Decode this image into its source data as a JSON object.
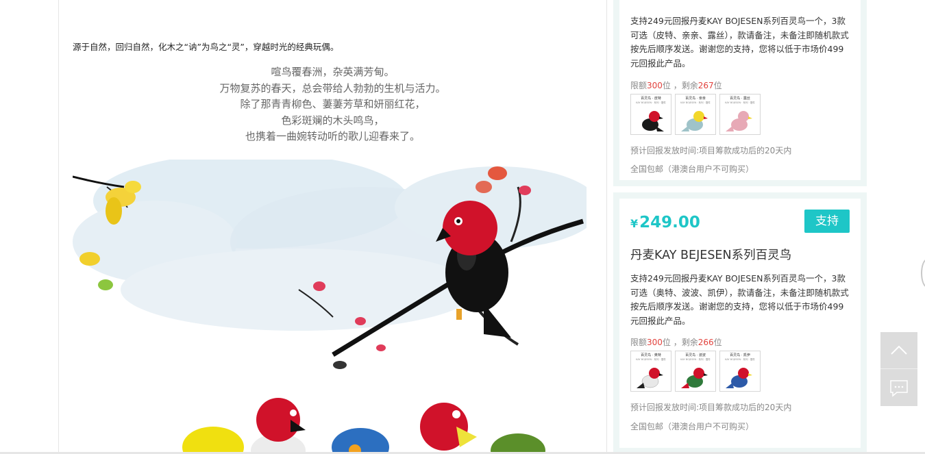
{
  "left": {
    "intro": "源于自然，回归自然，化木之“讷”为鸟之“灵”，穿越时光的经典玩偶。",
    "poem": [
      "喧鸟覆春洲，杂英满芳甸。",
      "万物复苏的春天，总会带给人勃勃的生机与活力。",
      "除了那青青柳色、萋萋芳草和妍丽红花，",
      "色彩斑斓的木头鸣鸟，",
      "也携着一曲婉转动听的歌儿迎春来了。"
    ]
  },
  "rewards": [
    {
      "description": "支持249元回报丹麦KAY BOJESEN系列百灵鸟一个，3款可选（皮特、亲亲、露丝），款请备注，未备注即随机款式按先后顺序发送。谢谢您的支持，您将以低于市场价499元回报此产品。",
      "quota_prefix": "限额",
      "quota_total": "300",
      "quota_mid": "位 ，剩余",
      "quota_left": "267",
      "quota_suffix": "位",
      "thumbs": [
        {
          "caption": "百灵鸟 · 皮特",
          "sub": "KAY BOJESEN · 系列 · 摆件",
          "color": "#1a1a1a"
        },
        {
          "caption": "百灵鸟 · 亲亲",
          "sub": "KAY BOJESEN · 系列 · 摆件",
          "color": "#9fc3c9"
        },
        {
          "caption": "百灵鸟 · 露丝",
          "sub": "KAY BOJESEN · 系列 · 摆件",
          "color": "#e7a9b6"
        }
      ],
      "delivery": "预计回报发放时间:项目筹款成功后的20天内",
      "shipping": "全国包邮（港澳台用户不可购买）"
    },
    {
      "currency": "¥",
      "price": "249.00",
      "button": "支持",
      "title": "丹麦KAY BEJESEN系列百灵鸟",
      "description": "支持249元回报丹麦KAY BOJESEN系列百灵鸟一个，3款可选（奥特、波波、凯伊），款请备注，未备注即随机款式按先后顺序发送。谢谢您的支持，您将以低于市场价499元回报此产品。",
      "quota_prefix": "限额",
      "quota_total": "300",
      "quota_mid": "位 ，剩余",
      "quota_left": "266",
      "quota_suffix": "位",
      "thumbs": [
        {
          "caption": "百灵鸟 · 奥特",
          "sub": "KAY BOJESEN · 系列 · 摆件",
          "color": "#e8e8e8"
        },
        {
          "caption": "百灵鸟 · 波波",
          "sub": "KAY BOJESEN · 系列 · 摆件",
          "color": "#2f7a3b"
        },
        {
          "caption": "百灵鸟 · 凯伊",
          "sub": "KAY BOJESEN · 系列 · 摆件",
          "color": "#2d5aa8"
        }
      ],
      "delivery": "预计回报发放时间:项目筹款成功后的20天内",
      "shipping": "全国包邮（港澳台用户不可购买）"
    }
  ],
  "side_tools": {
    "top_icon": "chevron-up-icon",
    "chat_icon": "chat-icon"
  },
  "colors": {
    "accent": "#1ec6c7",
    "highlight": "#e2413c",
    "card_bg": "#eef6f5"
  }
}
